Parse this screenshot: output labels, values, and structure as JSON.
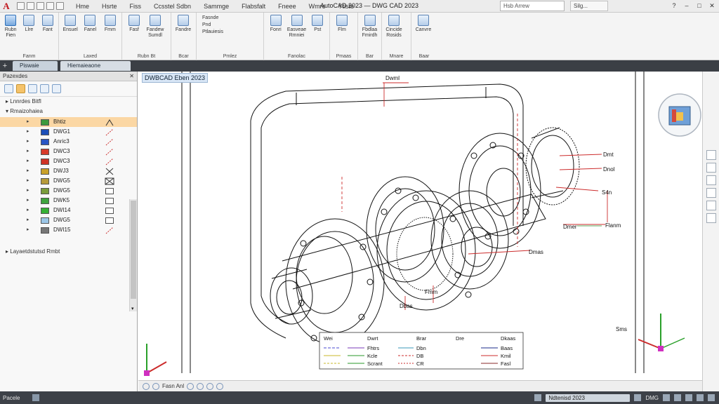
{
  "titlebar": {
    "app_logo": "A",
    "menu": [
      "Hme",
      "Hsrte",
      "Fiss",
      "Ccsstel Sdbn",
      "Sammge",
      "Flabsfalt",
      "Fneee",
      "Wmre",
      "Ytiste"
    ],
    "doc_title": "AutoCAD 2023 — DWG CAD 2023",
    "search_text": "Hsb Arrew",
    "signin_text": "Silg..."
  },
  "ribbon": {
    "groups": [
      {
        "label": "Fanm",
        "buttons": [
          "Rubn Fien",
          "Llre",
          "Fant"
        ]
      },
      {
        "label": "Laxed",
        "buttons": [
          "Ensuel",
          "Fanel",
          "Fmm"
        ]
      },
      {
        "label": "Rubn Bt",
        "buttons": [
          "Fasf",
          "Fandew Sumdl"
        ]
      },
      {
        "label": "Bcar",
        "buttons": [
          "Fandre"
        ]
      },
      {
        "label": "Pmlez",
        "buttons": [
          "Fasnde",
          "Pnd",
          "Ptlauiesis"
        ]
      },
      {
        "label": "Fanolac",
        "buttons": [
          "Fonri",
          "Easveae Rmniei",
          "Pst"
        ]
      },
      {
        "label": "Pmaas",
        "buttons": [
          "Flm"
        ]
      },
      {
        "label": "Bar",
        "buttons": [
          "Fbdlaa Fmirdh"
        ]
      },
      {
        "label": "Mnare",
        "buttons": [
          "Cincide Rosids"
        ]
      },
      {
        "label": "Baar",
        "buttons": [
          "Canvre"
        ]
      }
    ]
  },
  "tabs": {
    "first": "Piswaie",
    "second": "Hiemaieaone"
  },
  "panel": {
    "title": "Pazexdes",
    "row_layers": "Lnnrdes Bitfl",
    "row_group": "Rmaizohaiea",
    "row_bottom": "Layaetdstutsd Rmbt",
    "layers": [
      {
        "name": "Bhtiz",
        "color": "#3c9a3c"
      },
      {
        "name": "DWG1",
        "color": "#1c4fb8"
      },
      {
        "name": "Anric3",
        "color": "#2855c4"
      },
      {
        "name": "DWC3",
        "color": "#d73b2a"
      },
      {
        "name": "DWC3",
        "color": "#cf3325"
      },
      {
        "name": "DWJ3",
        "color": "#c9a028"
      },
      {
        "name": "DWG5",
        "color": "#b69a3a"
      },
      {
        "name": "DWG5",
        "color": "#7a9c3c"
      },
      {
        "name": "DWK5",
        "color": "#3ea33e"
      },
      {
        "name": "DWI14",
        "color": "#35b035"
      },
      {
        "name": "DWG5",
        "color": "#9cc6e6"
      },
      {
        "name": "DWI15",
        "color": "#777777"
      }
    ]
  },
  "canvas": {
    "title": "DWBCAD Eben 2023",
    "callouts": [
      "Dwml",
      "Dmt",
      "Dnol",
      "S4n",
      "Dmer",
      "Flanm",
      "Dmas",
      "Fmm",
      "Dbas",
      "Sms"
    ],
    "legend": {
      "headers": [
        "Wei",
        "Dwrt",
        "Brar",
        "Dre",
        "Dkaas"
      ],
      "rows": [
        [
          "Fhtrs",
          "Dbn",
          "Baas"
        ],
        [
          "Kcle",
          "DB",
          "Kmil"
        ],
        [
          "Scrant",
          "CR",
          "Fasl"
        ]
      ]
    },
    "bottom_label": "Fasn Anl"
  },
  "statusbar": {
    "mode": "Pacele",
    "file_name": "Ndtenisd 2023",
    "dwg_label": "DMG"
  }
}
